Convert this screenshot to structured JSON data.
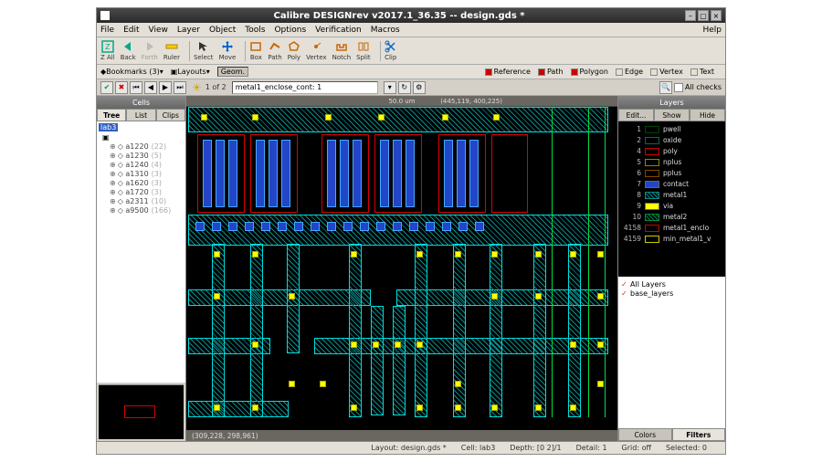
{
  "window": {
    "title": "Calibre DESIGNrev v2017.1_36.35  --  design.gds *"
  },
  "menu": {
    "file": "File",
    "edit": "Edit",
    "view": "View",
    "layer": "Layer",
    "object": "Object",
    "tools": "Tools",
    "options": "Options",
    "verification": "Verification",
    "macros": "Macros",
    "help": "Help"
  },
  "toolbar": {
    "zall": "Z All",
    "back": "Back",
    "forth": "Forth",
    "ruler": "Ruler",
    "select": "Select",
    "move": "Move",
    "box": "Box",
    "path": "Path",
    "poly": "Poly",
    "vertex": "Vertex",
    "notch": "Notch",
    "split": "Split",
    "clip": "Clip"
  },
  "toolbar2": {
    "bookmarks": "Bookmarks (3)",
    "layouts": "Layouts ",
    "geom": "Geom.",
    "reference": "Reference",
    "path": "Path",
    "polygon": "Polygon",
    "edge": "Edge",
    "vertex": "Vertex",
    "text": "Text"
  },
  "errbar": {
    "count": "1 of 2",
    "rule": "metal1_enclose_cont: 1",
    "allchecks": "All checks"
  },
  "ruler": {
    "scale": "50.0 um",
    "coords": "(445,119,  400,225)"
  },
  "cells": {
    "title": "Cells",
    "tabs": {
      "tree": "Tree",
      "list": "List",
      "clips": "Clips"
    },
    "root": "lab3",
    "items": [
      {
        "name": "a1220",
        "count": "(22)"
      },
      {
        "name": "a1230",
        "count": "(5)"
      },
      {
        "name": "a1240",
        "count": "(4)"
      },
      {
        "name": "a1310",
        "count": "(3)"
      },
      {
        "name": "a1620",
        "count": "(3)"
      },
      {
        "name": "a1720",
        "count": "(3)"
      },
      {
        "name": "a2311",
        "count": "(10)"
      },
      {
        "name": "a9500",
        "count": "(166)"
      }
    ]
  },
  "canvas": {
    "bottom_coords": "(309,228,  298,961)"
  },
  "layers": {
    "title": "Layers",
    "btns": {
      "edit": "Edit...",
      "show": "Show",
      "hide": "Hide"
    },
    "rows": [
      {
        "num": "1",
        "name": "pwell",
        "color": "#004400",
        "style": "outline"
      },
      {
        "num": "2",
        "name": "oxide",
        "color": "#006666",
        "style": "outline"
      },
      {
        "num": "4",
        "name": "poly",
        "color": "#cc0000",
        "style": "outline"
      },
      {
        "num": "5",
        "name": "nplus",
        "color": "#888800",
        "style": "outline"
      },
      {
        "num": "6",
        "name": "pplus",
        "color": "#884400",
        "style": "outline"
      },
      {
        "num": "7",
        "name": "contact",
        "color": "#2345c8",
        "style": "fill"
      },
      {
        "num": "8",
        "name": "metal1",
        "color": "#0a8a8a",
        "style": "hatch"
      },
      {
        "num": "9",
        "name": "via",
        "color": "#ffff00",
        "style": "fill"
      },
      {
        "num": "10",
        "name": "metal2",
        "color": "#008844",
        "style": "hatch"
      },
      {
        "num": "4158",
        "name": "metal1_enclo",
        "color": "#cc0000",
        "style": "outline"
      },
      {
        "num": "4159",
        "name": "min_metal1_v",
        "color": "#cccc00",
        "style": "outline"
      }
    ],
    "filters": {
      "all": "All Layers",
      "base": "base_layers"
    },
    "bottom_tabs": {
      "colors": "Colors",
      "filters": "Filters"
    }
  },
  "status": {
    "layout": "Layout: design.gds *",
    "cell": "Cell: lab3",
    "depth": "Depth: [0 2]/1",
    "detail": "Detail: 1",
    "grid": "Grid: off",
    "selected": "Selected: 0"
  }
}
